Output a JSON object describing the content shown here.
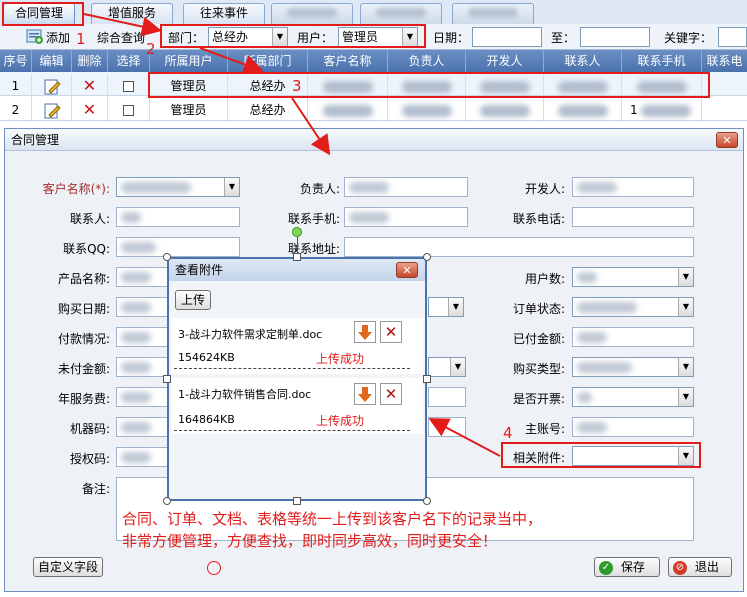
{
  "tabs": [
    {
      "label": "合同管理"
    },
    {
      "label": "增值服务"
    },
    {
      "label": "往来事件"
    }
  ],
  "toolbar": {
    "add_label": "添加",
    "query_label": "综合查询",
    "dept_label": "部门：",
    "dept_value": "总经办",
    "user_label": "用户：",
    "user_value": "管理员",
    "date_label": "日期：",
    "to_label": "至：",
    "keyword_label": "关键字："
  },
  "grid": {
    "headers": [
      "序号",
      "编辑",
      "删除",
      "选择",
      "所属用户",
      "所属部门",
      "客户名称",
      "负责人",
      "开发人",
      "联系人",
      "联系手机",
      "联系电"
    ],
    "rows": [
      {
        "no": "1",
        "user": "管理员",
        "dept": "总经办"
      },
      {
        "no": "2",
        "user": "管理员",
        "dept": "总经办",
        "phone_prefix": "1"
      }
    ]
  },
  "dialog": {
    "title": "合同管理",
    "close_glyph": "✕",
    "fields": {
      "customer": "客户名称(*):",
      "owner": "负责人:",
      "developer": "开发人:",
      "contact": "联系人:",
      "mobile": "联系手机:",
      "phone": "联系电话:",
      "qq": "联系QQ:",
      "address": "联系地址:",
      "product": "产品名称:",
      "user_count": "用户数:",
      "buy_date": "购买日期:",
      "order_status": "订单状态:",
      "payment": "付款情况:",
      "paid": "已付金额:",
      "unpaid": "未付金额:",
      "buy_type": "购买类型:",
      "annual_fee": "年服务费:",
      "invoice": "是否开票:",
      "machine": "机器码:",
      "main_account": "主账号:",
      "auth": "授权码:",
      "attachments": "相关附件:",
      "remark": "备注:"
    },
    "custom_field_button": "自定义字段",
    "save_button": "保存",
    "exit_button": "退出"
  },
  "attachment_dialog": {
    "title": "查看附件",
    "upload_button": "上传",
    "close_glyph": "✕",
    "files": [
      {
        "name": "3-战斗力软件需求定制单.doc",
        "size": "154624KB",
        "status": "上传成功"
      },
      {
        "name": "1-战斗力软件销售合同.doc",
        "size": "164864KB",
        "status": "上传成功"
      }
    ]
  },
  "annotations": {
    "num1": "1",
    "num2": "2",
    "num3": "3",
    "num4": "4",
    "line1": "合同、订单、文档、表格等统一上传到该客户名下的记录当中，",
    "line2": "非常方便管理，方便查找，即时同步高效，同时更安全！"
  },
  "colors": {
    "accent_red": "#e21b1b",
    "header_blue": "#4a72ae"
  }
}
